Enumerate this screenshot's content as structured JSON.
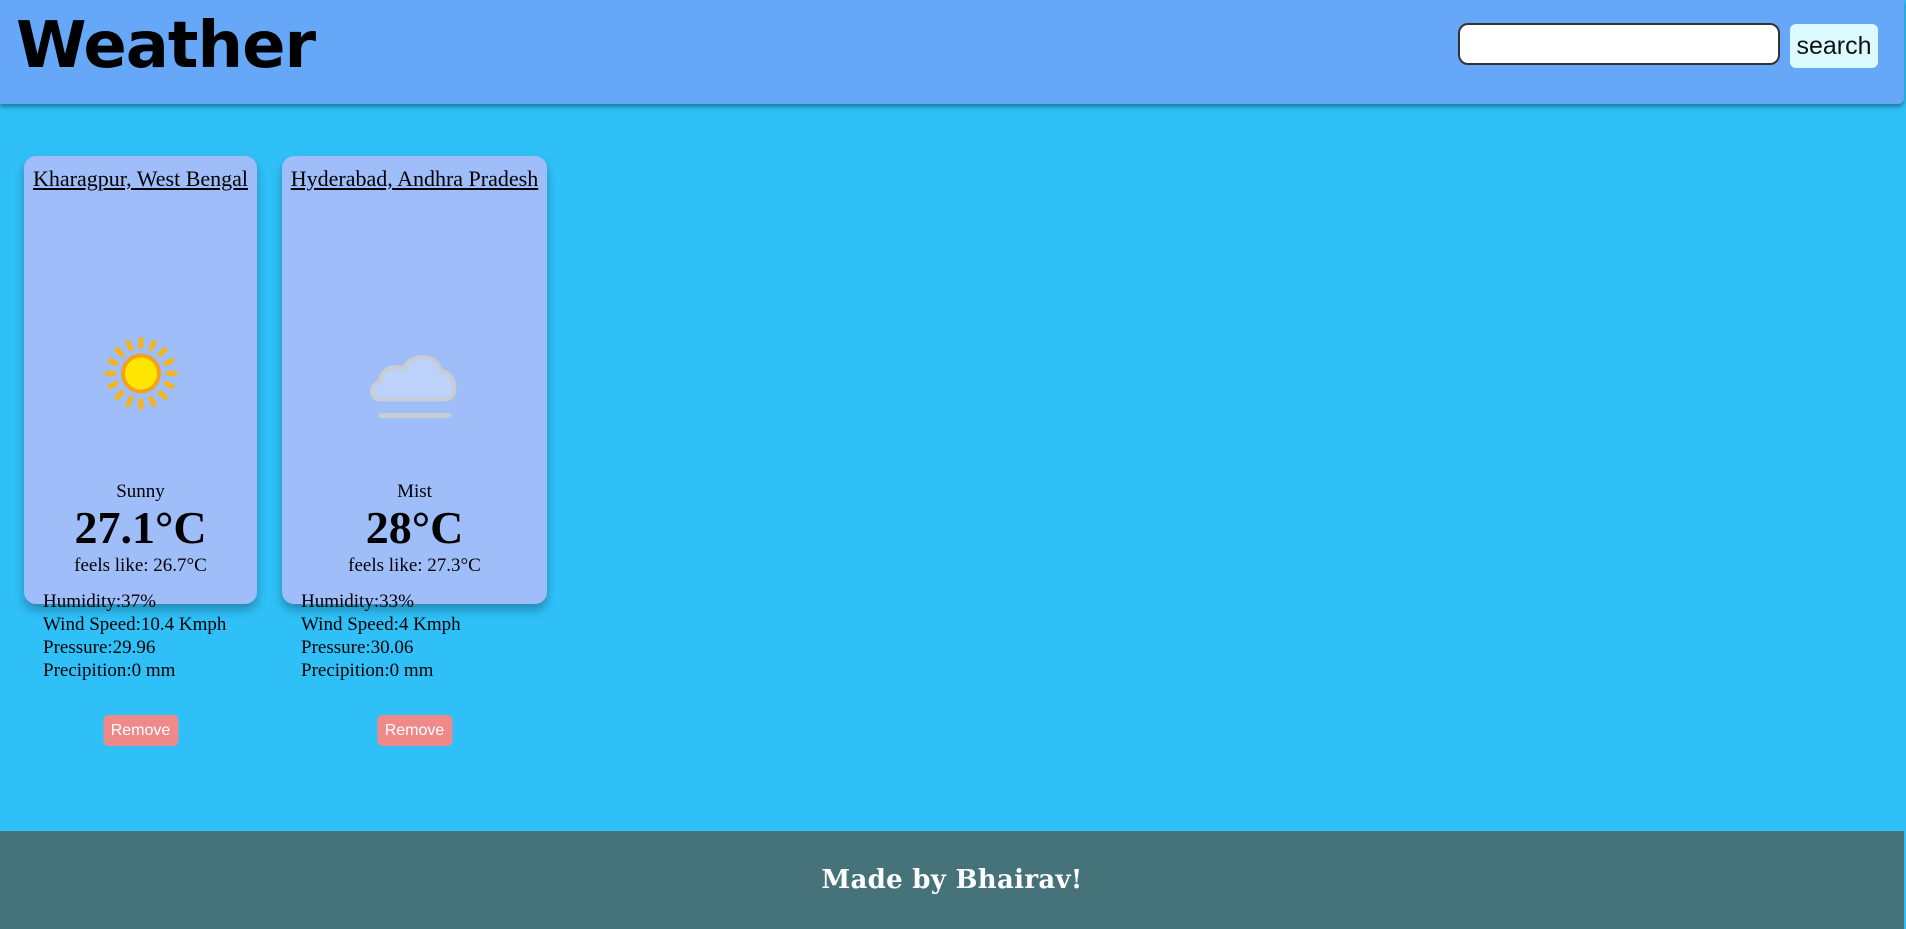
{
  "header": {
    "title": "Weather",
    "search": {
      "value": "",
      "placeholder": ""
    },
    "search_label": "search"
  },
  "cards": [
    {
      "location": "Kharagpur, West Bengal",
      "icon": "sun-icon",
      "condition": "Sunny",
      "temperature": "27.1°C",
      "feels_like": "feels like: 26.7°C",
      "humidity": "Humidity:37%",
      "wind_speed": "Wind Speed:10.4 Kmph",
      "pressure": "Pressure:29.96",
      "precipitation": "Precipition:0 mm",
      "remove_label": "Remove"
    },
    {
      "location": "Hyderabad, Andhra Pradesh",
      "icon": "mist-cloud-icon",
      "condition": "Mist",
      "temperature": "28°C",
      "feels_like": "feels like: 27.3°C",
      "humidity": "Humidity:33%",
      "wind_speed": "Wind Speed:4 Kmph",
      "pressure": "Pressure:30.06",
      "precipitation": "Precipition:0 mm",
      "remove_label": "Remove"
    }
  ],
  "footer": {
    "text": "Made by Bhairav!"
  },
  "colors": {
    "page_background": "#2fc0f8",
    "header_background": "#66a8f7",
    "card_background": "#9ebdf9",
    "remove_button": "#f08a8a",
    "footer_background": "#467279"
  }
}
